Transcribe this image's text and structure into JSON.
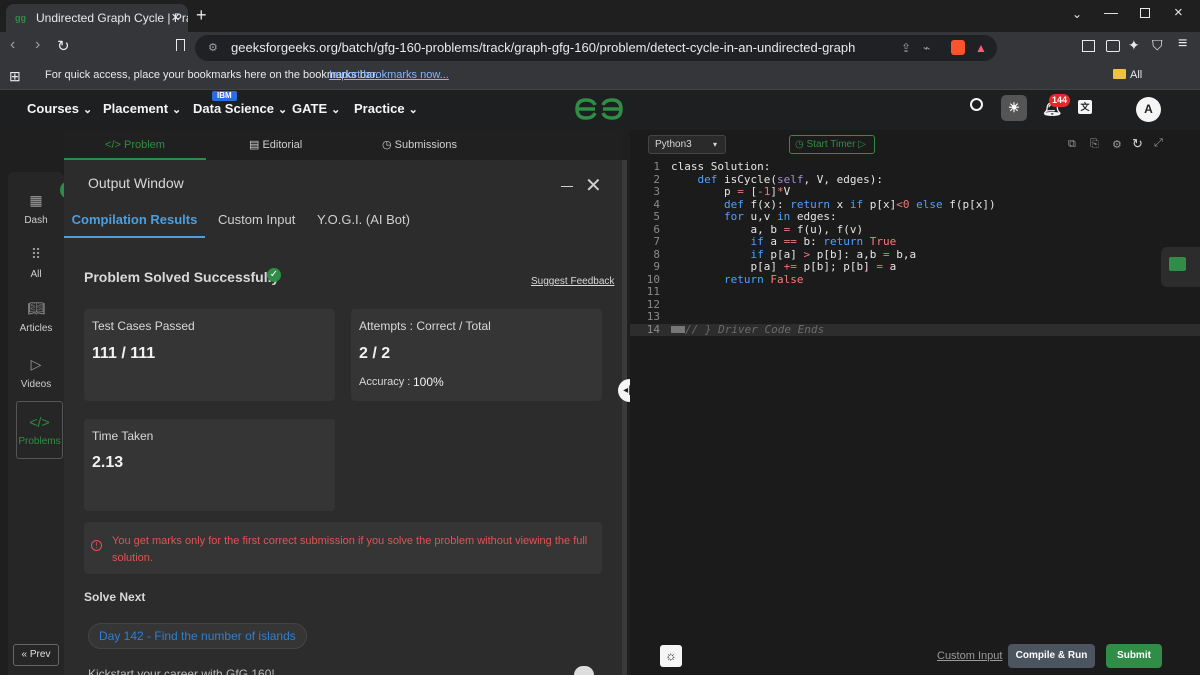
{
  "browser": {
    "tab_title": "Undirected Graph Cycle | Practi",
    "tab_favicon": "gfg-favicon",
    "url": "geeksforgeeks.org/batch/gfg-160-problems/track/graph-gfg-160/problem/detect-cycle-in-an-undirected-graph",
    "bookmarks_text": "For quick access, place your bookmarks here on the bookmarks bar.",
    "import_bookmarks": "Import bookmarks now...",
    "all_bookmarks": "All Bookmarks"
  },
  "nav": {
    "items": [
      "Courses",
      "Placement",
      "Data Science",
      "GATE",
      "Practice"
    ],
    "ibm_badge": "IBM",
    "notif_count": "144",
    "avatar": "A"
  },
  "sidebar": {
    "items": [
      "Dash",
      "All",
      "Articles",
      "Videos",
      "Problems"
    ],
    "prev": "« Prev"
  },
  "left_tabs": [
    "Problem",
    "Editorial",
    "Submissions"
  ],
  "output": {
    "window_title": "Output Window",
    "tabs": [
      "Compilation Results",
      "Custom Input",
      "Y.O.G.I. (AI Bot)"
    ],
    "status": "Problem Solved Successfully",
    "suggest_feedback": "Suggest Feedback",
    "tc_label": "Test Cases Passed",
    "tc_value": "111 / 111",
    "attempts_label": "Attempts : Correct / Total",
    "attempts_value": "2 / 2",
    "accuracy_label": "Accuracy :",
    "accuracy_value": "100%",
    "time_label": "Time Taken",
    "time_value": "2.13",
    "warning": "You get marks only for the first correct submission if you solve the problem without viewing the full solution.",
    "solve_next": "Solve Next",
    "next_problem": "Day 142 - Find the number of islands",
    "cut_text": "Kickstart your career with GfG 160!"
  },
  "editor": {
    "language": "Python3",
    "timer": "Start Timer",
    "line_numbers": [
      "1",
      "2",
      "3",
      "4",
      "5",
      "6",
      "7",
      "8",
      "9",
      "10",
      "11",
      "12",
      "13",
      "14"
    ],
    "custom_input": "Custom Input",
    "compile_run": "Compile & Run",
    "submit": "Submit"
  },
  "colors": {
    "accent": "#2f8d46",
    "brand": "#2f8d46",
    "warning": "#e05353"
  }
}
